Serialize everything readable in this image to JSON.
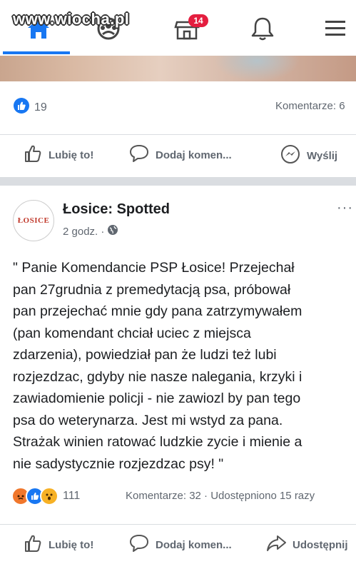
{
  "watermark": "www.wiocha.pl",
  "nav": {
    "items": [
      {
        "name": "home",
        "icon": "home-icon",
        "active": true
      },
      {
        "name": "groups",
        "icon": "groups-icon"
      },
      {
        "name": "marketplace",
        "icon": "marketplace-icon",
        "badge": "14"
      },
      {
        "name": "notifications",
        "icon": "bell-icon"
      },
      {
        "name": "menu",
        "icon": "hamburger-icon"
      }
    ]
  },
  "prev_post": {
    "like_count": "19",
    "comments_label": "Komentarze: 6",
    "actions": {
      "like": "Lubię to!",
      "comment": "Dodaj komen...",
      "send": "Wyślij"
    }
  },
  "post": {
    "page_name": "Łosice: Spotted",
    "time": "2 godz. ·",
    "avatar_text": "ŁOSICE",
    "more": "···",
    "text": "\" Panie Komendancie PSP Łosice! Przejechał\npan 27grudnia z premedytacją psa, próbował\npan przejechać mnie gdy pana zatrzymywałem\n(pan komendant chciał uciec z miejsca\nzdarzenia), powiedział pan że ludzi też lubi\nrozjezdzac, gdyby nie nasze nalegania, krzyki i\nzawiadomienie policji - nie zawiozl by pan tego\npsa do weterynarza. Jest mi wstyd za pana.\nStrażak winien ratować ludzkie zycie i mienie a\nnie sadystycznie rozjezdzac psy! \"",
    "reactions_count": "111",
    "meta": "Komentarze: 32 · Udostępniono 15 razy",
    "actions": {
      "like": "Lubię to!",
      "comment": "Dodaj komen...",
      "share": "Udostępnij"
    }
  },
  "colors": {
    "accent": "#1877f2",
    "badge": "#e41e3f",
    "angry": "#f0772c",
    "wow": "#f7b125"
  }
}
